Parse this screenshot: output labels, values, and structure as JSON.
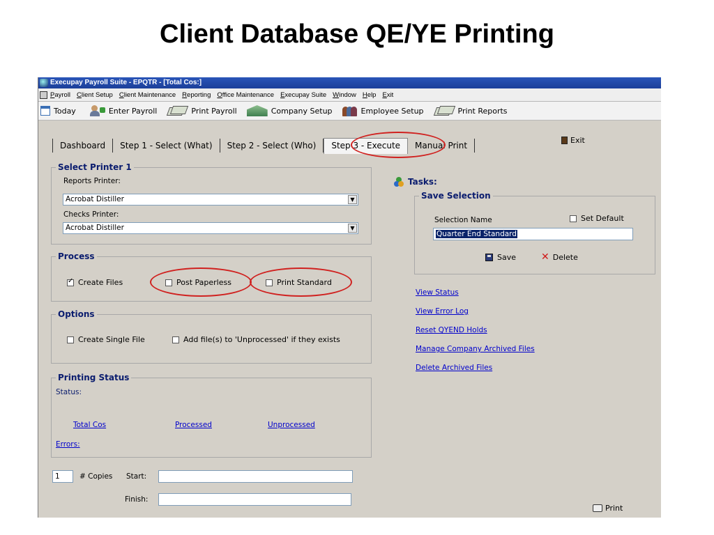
{
  "slide": {
    "title": "Client Database QE/YE Printing"
  },
  "window": {
    "title": "Execupay Payroll Suite - EPQTR - [Total Cos:]"
  },
  "menu": [
    "Payroll",
    "Client Setup",
    "Client Maintenance",
    "Reporting",
    "Office Maintenance",
    "Execupay Suite",
    "Window",
    "Help",
    "Exit"
  ],
  "toolbar": {
    "today": "Today",
    "enter_payroll": "Enter Payroll",
    "print_payroll": "Print Payroll",
    "company_setup": "Company Setup",
    "employee_setup": "Employee Setup",
    "print_reports": "Print Reports"
  },
  "tabs": [
    "Dashboard",
    "Step 1 - Select (What)",
    "Step 2 - Select (Who)",
    "Step 3 - Execute",
    "Manual Print"
  ],
  "exit_label": "Exit",
  "select_printer": {
    "legend": "Select Printer 1",
    "reports_label": "Reports Printer:",
    "reports_value": "Acrobat Distiller",
    "checks_label": "Checks Printer:",
    "checks_value": "Acrobat Distiller"
  },
  "process": {
    "legend": "Process",
    "create_files": "Create Files",
    "create_files_checked": true,
    "post_paperless": "Post Paperless",
    "print_standard": "Print Standard"
  },
  "options": {
    "legend": "Options",
    "create_single_file": "Create Single File",
    "add_files": "Add file(s) to 'Unprocessed' if they exists"
  },
  "printing_status": {
    "legend": "Printing Status",
    "status_label": "Status:",
    "total_cos": "Total Cos",
    "processed": "Processed",
    "unprocessed": "Unprocessed",
    "errors": "Errors:"
  },
  "copies": {
    "value": "1",
    "label": "# Copies",
    "start_label": "Start:",
    "finish_label": "Finish:"
  },
  "tasks": {
    "title": "Tasks:",
    "save_selection": {
      "legend": "Save Selection",
      "name_label": "Selection Name",
      "set_default": "Set Default",
      "name_value": "Quarter End Standard",
      "save": "Save",
      "delete": "Delete"
    },
    "links": [
      "View Status",
      "View Error Log",
      "Reset QYEND Holds",
      "Manage Company Archived Files",
      "Delete Archived Files"
    ]
  },
  "print_label": "Print",
  "colors": {
    "accent": "#0a1c6e",
    "link": "#0000cc",
    "highlight": "#d0211f"
  }
}
